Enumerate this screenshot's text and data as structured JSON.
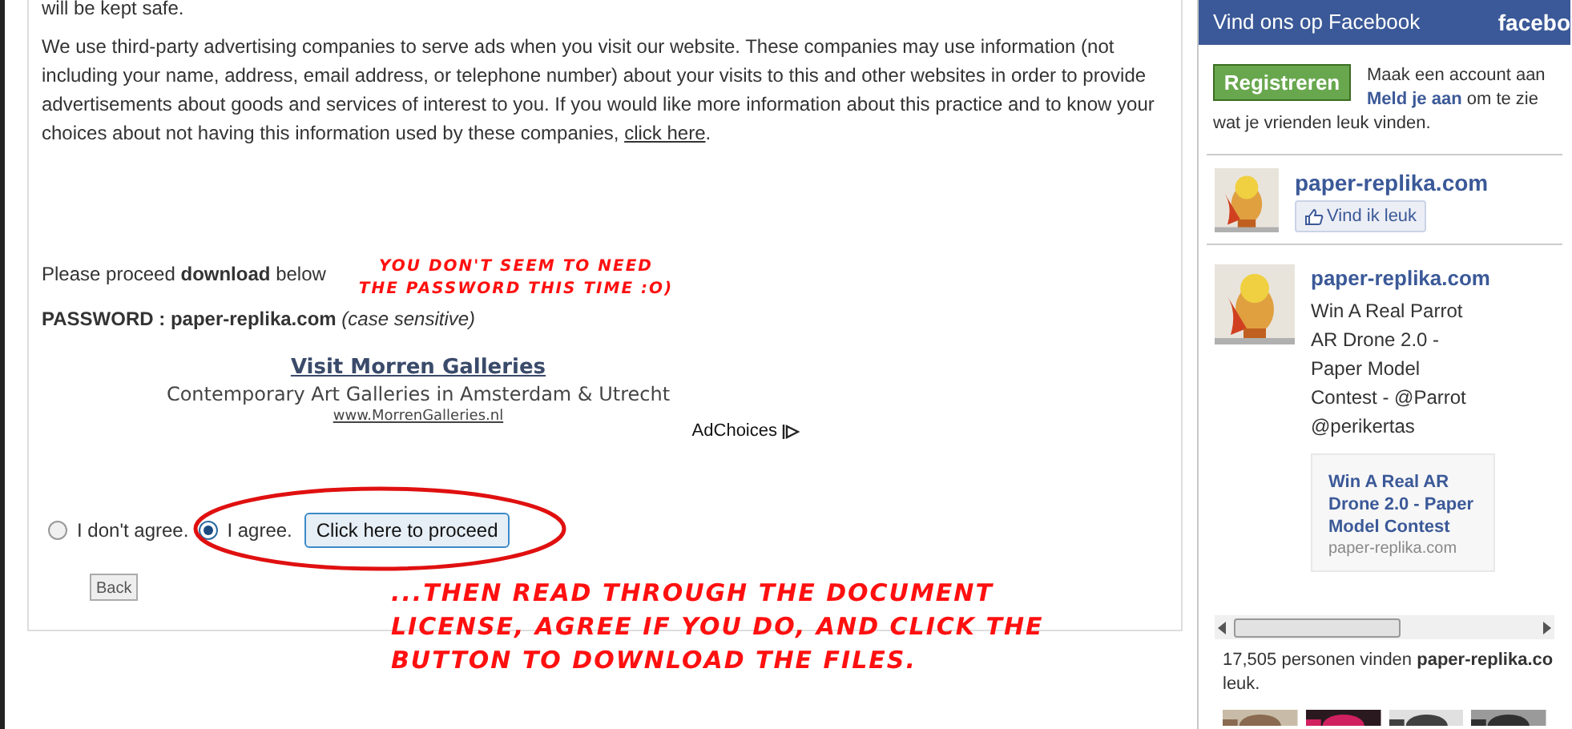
{
  "article": {
    "intro_tail": "will be kept safe.",
    "ads_paragraph": "We use third-party advertising companies to serve ads when you visit our website. These companies may use information (not including your name, address, email address, or telephone number) about your visits to this and other websites in order to provide advertisements about goods and services of interest to you. If you would like more information about this practice and to know your choices about not having this information used by these companies,",
    "ads_link": "click here",
    "ads_end": ".",
    "proceed_text": "Please proceed **download** below",
    "password_label": "PASSWORD : paper-replika.com",
    "password_note": "(case sensitive)",
    "ad": {
      "title": "Visit Morren Galleries",
      "subtitle": "Contemporary Art Galleries in Amsterdam & Utrecht",
      "url": "www.MorrenGalleries.nl",
      "adchoices": "AdChoices"
    },
    "agreement": [
      {
        "label": "I don't agree.",
        "selected": false
      },
      {
        "label": "I agree.",
        "selected": true
      }
    ],
    "proceed_button": "Click here to proceed",
    "back_button": "Back"
  },
  "annotations": [
    {
      "text": "YOU DON'T SEEM TO NEED THE PASSWORD THIS TIME :O)"
    },
    {
      "text": "...THEN READ THROUGH THE DOCUMENT LICENSE, AGREE IF YOU DO, AND CLICK THE BUTTON TO DOWNLOAD THE FILES."
    }
  ],
  "facebook": {
    "header": "Vind ons op Facebook",
    "logo": "facebo",
    "register_button": "Registreren",
    "register_text_1": "Maak een account aan",
    "login_link": "Meld je aan",
    "register_text_2": "om te zie",
    "register_text_3": "wat je vrienden leuk vinden.",
    "page_name": "paper-replika.com",
    "like_button": "Vind ik leuk",
    "post": {
      "author": "paper-replika.com",
      "text": "Win A Real Parrot AR Drone 2.0 - Paper Model Contest - @Parrot @perikertas",
      "card_title": "Win A Real AR Drone 2.0 - Paper Model Contest",
      "card_source": "paper-replika.com"
    },
    "fans_count": "17,505 personen vinden",
    "fans_page": "paper-replika.co",
    "fans_end": "leuk."
  }
}
